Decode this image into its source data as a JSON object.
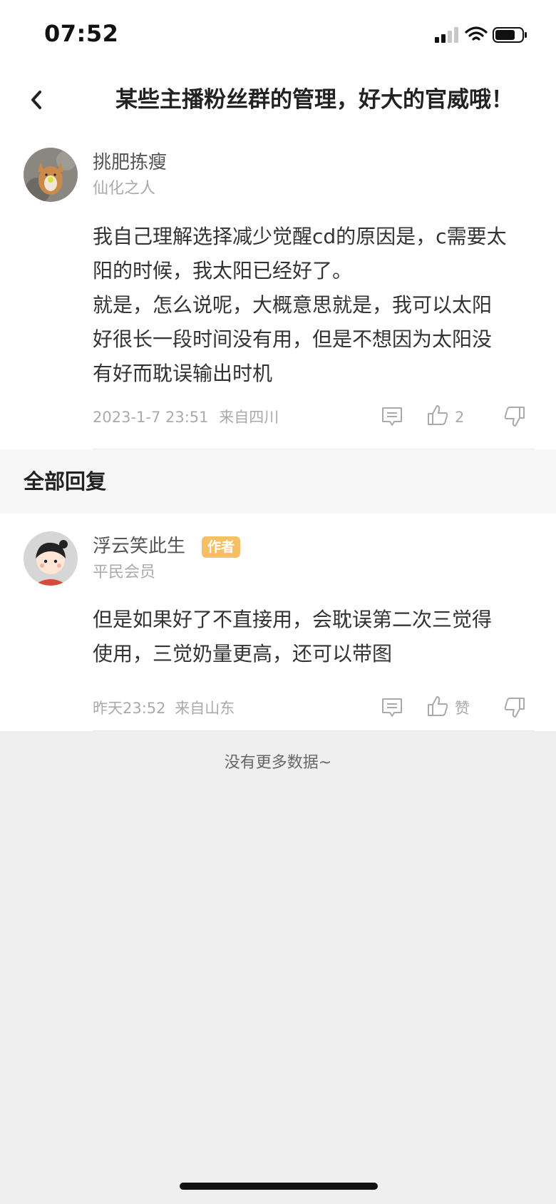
{
  "status_bar": {
    "time": "07:52",
    "icons": [
      "cellular-signal-icon",
      "wifi-icon",
      "battery-icon"
    ]
  },
  "nav": {
    "back_icon": "chevron-left-icon",
    "title": "某些主播粉丝群的管理，好大的官威哦！"
  },
  "main_comment": {
    "author": "挑肥拣瘦",
    "rank": "仙化之人",
    "body_lines": [
      "我自己理解选择减少觉醒cd的原因是，c需要太",
      "阳的时候，我太阳已经好了。",
      "就是，怎么说呢，大概意思就是，我可以太阳",
      "好很长一段时间没有用，但是不想因为太阳没",
      "有好而耽误输出时机"
    ],
    "timestamp": "2023-1-7 23:51",
    "location": "来自四川",
    "like_count": "2"
  },
  "section": {
    "title": "全部回复"
  },
  "reply": {
    "author": "浮云笑此生",
    "badge": "作者",
    "rank": "平民会员",
    "body_lines": [
      "但是如果好了不直接用，会耽误第二次三觉得",
      "使用，三觉奶量更高，还可以带图"
    ],
    "timestamp": "昨天23:52",
    "location": "来自山东",
    "like_label": "赞"
  },
  "footer": {
    "no_more": "没有更多数据~"
  },
  "colors": {
    "badge_bg": "#f5c063",
    "page_bg": "#efefef"
  }
}
